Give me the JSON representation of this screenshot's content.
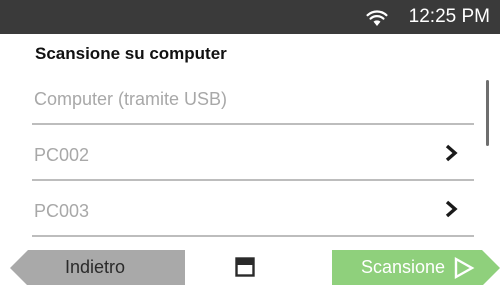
{
  "status_bar": {
    "wifi_icon": "wifi-icon",
    "time": "12:25 PM"
  },
  "header": {
    "title": "Scansione su computer"
  },
  "list": {
    "items": [
      {
        "label": "Computer (tramite USB)",
        "has_chevron": false
      },
      {
        "label": "PC002",
        "has_chevron": true
      },
      {
        "label": "PC003",
        "has_chevron": true
      }
    ]
  },
  "footer": {
    "back_label": "Indietro",
    "save_icon": "floppy-disk-icon",
    "scan_label": "Scansione"
  },
  "colors": {
    "status_bar_bg": "#3a3a3a",
    "back_button": "#a9a9a9",
    "scan_button": "#8fd07c",
    "divider": "#bdbdbd",
    "item_text": "#a8a8a8"
  }
}
